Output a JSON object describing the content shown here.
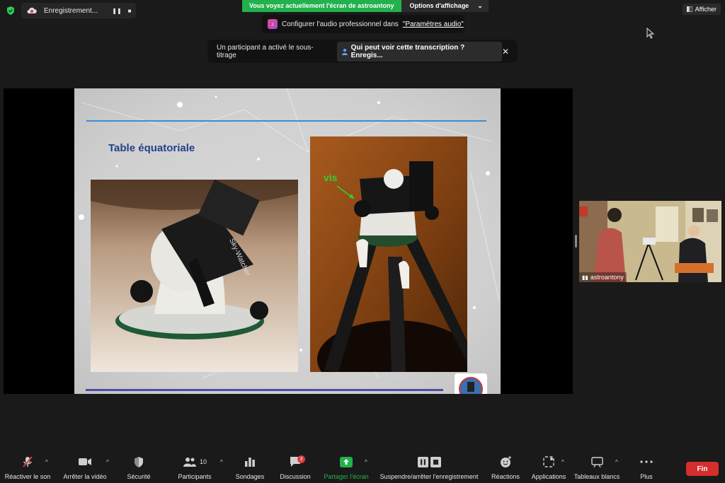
{
  "top": {
    "recording_label": "Enregistrement...",
    "sharing_banner": "Vous voyez actuellement l'écran de astroantony",
    "view_options": "Options d'affichage",
    "show_button": "Afficher"
  },
  "audio_banner": {
    "text": "Configurer l'audio professionnel dans",
    "link": "\"Paramètres audio\""
  },
  "caption_banner": {
    "text": "Un participant a activé le sous-titrage",
    "who_button": "Qui peut voir cette transcription ? Enregis..."
  },
  "slide": {
    "title": "Table équatoriale",
    "arrow_label": "vis"
  },
  "video": {
    "participant_name": "astroantony"
  },
  "toolbar": {
    "unmute": "Réactiver le son",
    "stop_video": "Arrêter la vidéo",
    "security": "Sécurité",
    "participants": "Participants",
    "participants_count": "10",
    "polls": "Sondages",
    "chat": "Discussion",
    "chat_badge": "3",
    "share": "Partager l'écran",
    "record": "Suspendre/arrêter l'enregistrement",
    "reactions": "Réactions",
    "apps": "Applications",
    "whiteboards": "Tableaux blancs",
    "more": "Plus",
    "end": "Fin"
  },
  "colors": {
    "accent_green": "#22b14c",
    "end_red": "#d62d2d",
    "slide_title": "#24418d",
    "vis_green": "#2fd12f"
  }
}
